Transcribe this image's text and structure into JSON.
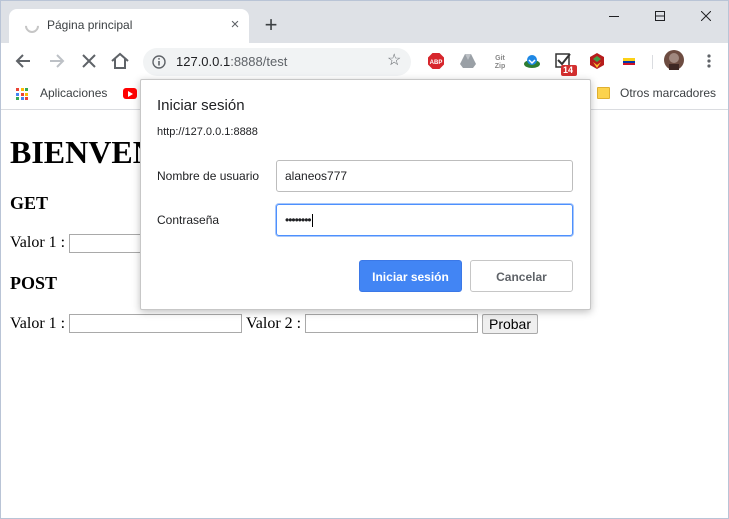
{
  "browser": {
    "tab": {
      "title": "Página principal",
      "close_glyph": "×"
    },
    "new_tab_glyph": "+",
    "address": {
      "host": "127.0.0.1",
      "port_path": ":8888/test",
      "star_glyph": "☆"
    },
    "extension_badge": "14",
    "extensions": [
      "adblock-plus-icon",
      "google-drive-icon",
      "git-zip-icon",
      "download-icon",
      "todo-check-icon",
      "flag-extension-icon",
      "colombia-flag-icon",
      "profile-avatar-icon"
    ]
  },
  "bookmarks": {
    "apps_label": "Aplicaciones",
    "other_label": "Otros marcadores"
  },
  "page": {
    "heading": "BIENVENIDO",
    "get": {
      "title": "GET",
      "valor1_label": "Valor 1 :"
    },
    "post": {
      "title": "POST",
      "valor1_label": "Valor 1 :",
      "valor2_label": "Valor 2 :",
      "submit_label": "Probar"
    }
  },
  "dialog": {
    "title": "Iniciar sesión",
    "origin": "http://127.0.0.1:8888",
    "username_label": "Nombre de usuario",
    "username_value": "alaneos777",
    "password_label": "Contraseña",
    "password_mask": "••••••••",
    "sign_in_label": "Iniciar sesión",
    "cancel_label": "Cancelar"
  }
}
